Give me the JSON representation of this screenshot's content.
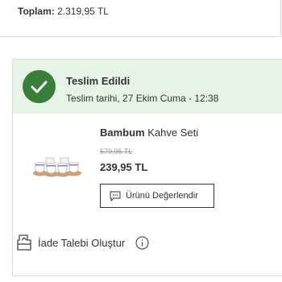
{
  "summary": {
    "total_label": "Toplam:",
    "total_value": "2.319,95 TL"
  },
  "order": {
    "status": {
      "title": "Teslim Edildi",
      "date_text": "Teslim tarihi, 27 Ekim Cuma - 12:38",
      "icon": "check-icon",
      "color": "#3a7e3b",
      "background": "#e8f3e7"
    },
    "product": {
      "brand": "Bambum",
      "name": "Kahve Seti",
      "old_price": "579,95 TL",
      "price": "239,95 TL",
      "image": "coffee-cup-set"
    },
    "rate_button_label": "Ürünü Değerlendir",
    "return_label": "İade Talebi Oluştur"
  }
}
